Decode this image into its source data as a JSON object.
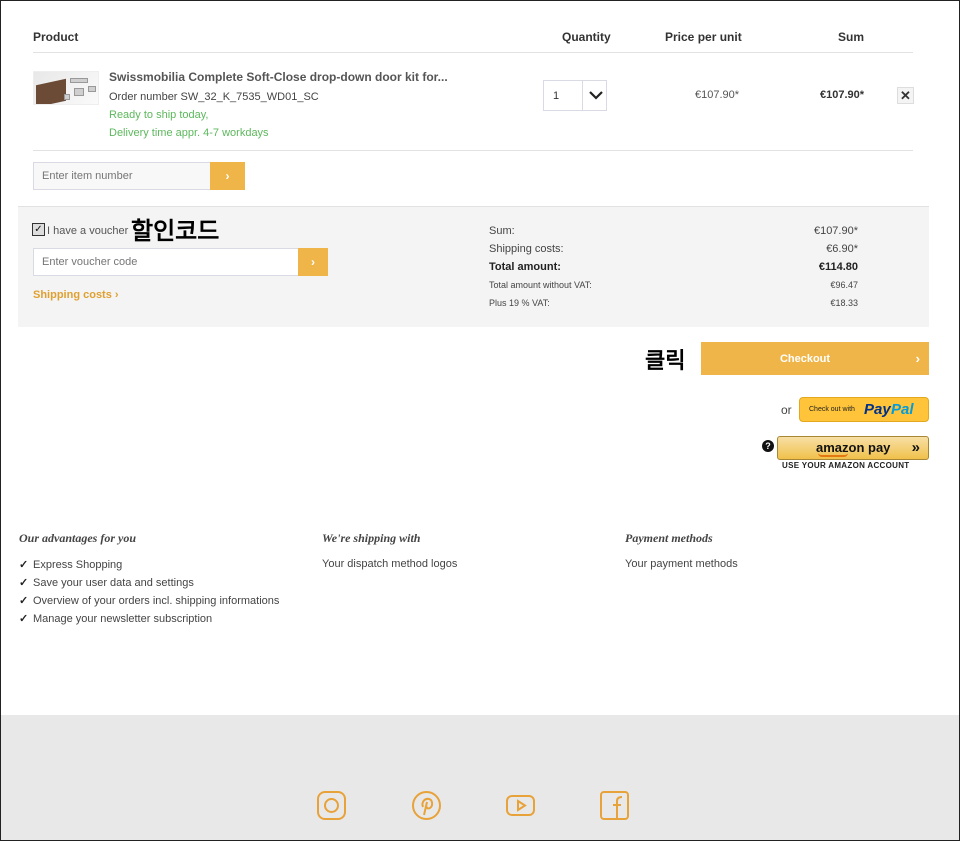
{
  "table_header": {
    "product": "Product",
    "quantity": "Quantity",
    "price_per_unit": "Price per unit",
    "sum": "Sum"
  },
  "cart_item": {
    "name": "Swissmobilia Complete Soft-Close drop-down door kit for...",
    "order_number": "Order number SW_32_K_7535_WD01_SC",
    "stock_status": "Ready to ship today,",
    "delivery_time": "Delivery time appr. 4-7 workdays",
    "quantity": "1",
    "unit_price": "€107.90*",
    "total": "€107.90*",
    "remove_icon": "close-icon"
  },
  "item_number_input": {
    "placeholder": "Enter item number",
    "button_icon": "chevron-right-icon",
    "button_glyph": "›"
  },
  "voucher": {
    "checkbox_label": "I have a voucher",
    "checked": true,
    "annotation": "할인코드",
    "placeholder": "Enter voucher code",
    "button_glyph": "›"
  },
  "shipping_link": "Shipping costs",
  "summary": {
    "rows": [
      {
        "label": "Sum:",
        "value": "€107.90*"
      },
      {
        "label": "Shipping costs:",
        "value": "€6.90*"
      },
      {
        "label": "Total amount:",
        "value": "€114.80"
      },
      {
        "label": "Total amount without VAT:",
        "value": "€96.47"
      },
      {
        "label": "Plus 19 % VAT:",
        "value": "€18.33"
      }
    ]
  },
  "checkout": {
    "annotation": "클릭",
    "label": "Checkout",
    "arrow": "›"
  },
  "alt_payment": {
    "or_label": "or",
    "paypal_small": "Check out with",
    "paypal_brand_1": "Pay",
    "paypal_brand_2": "Pal",
    "help_glyph": "?",
    "amazon_label": "amazon pay",
    "amazon_arrows": "»",
    "amazon_sub": "USE YOUR AMAZON ACCOUNT"
  },
  "advantages": {
    "title": "Our advantages for you",
    "items": [
      "Express Shopping",
      "Save your user data and settings",
      "Overview of your orders incl. shipping informations",
      "Manage your newsletter subscription"
    ]
  },
  "shipping_col": {
    "title": "We're shipping with",
    "text": "Your dispatch method logos"
  },
  "payment_col": {
    "title": "Payment methods",
    "text": "Your payment methods"
  },
  "social_icons": [
    "instagram-icon",
    "pinterest-icon",
    "youtube-icon",
    "facebook-icon"
  ],
  "colors": {
    "accent": "#f0b548",
    "green": "#5cb85c",
    "footer_bg": "#e8e8e8",
    "panel_bg": "#f4f4f4"
  }
}
